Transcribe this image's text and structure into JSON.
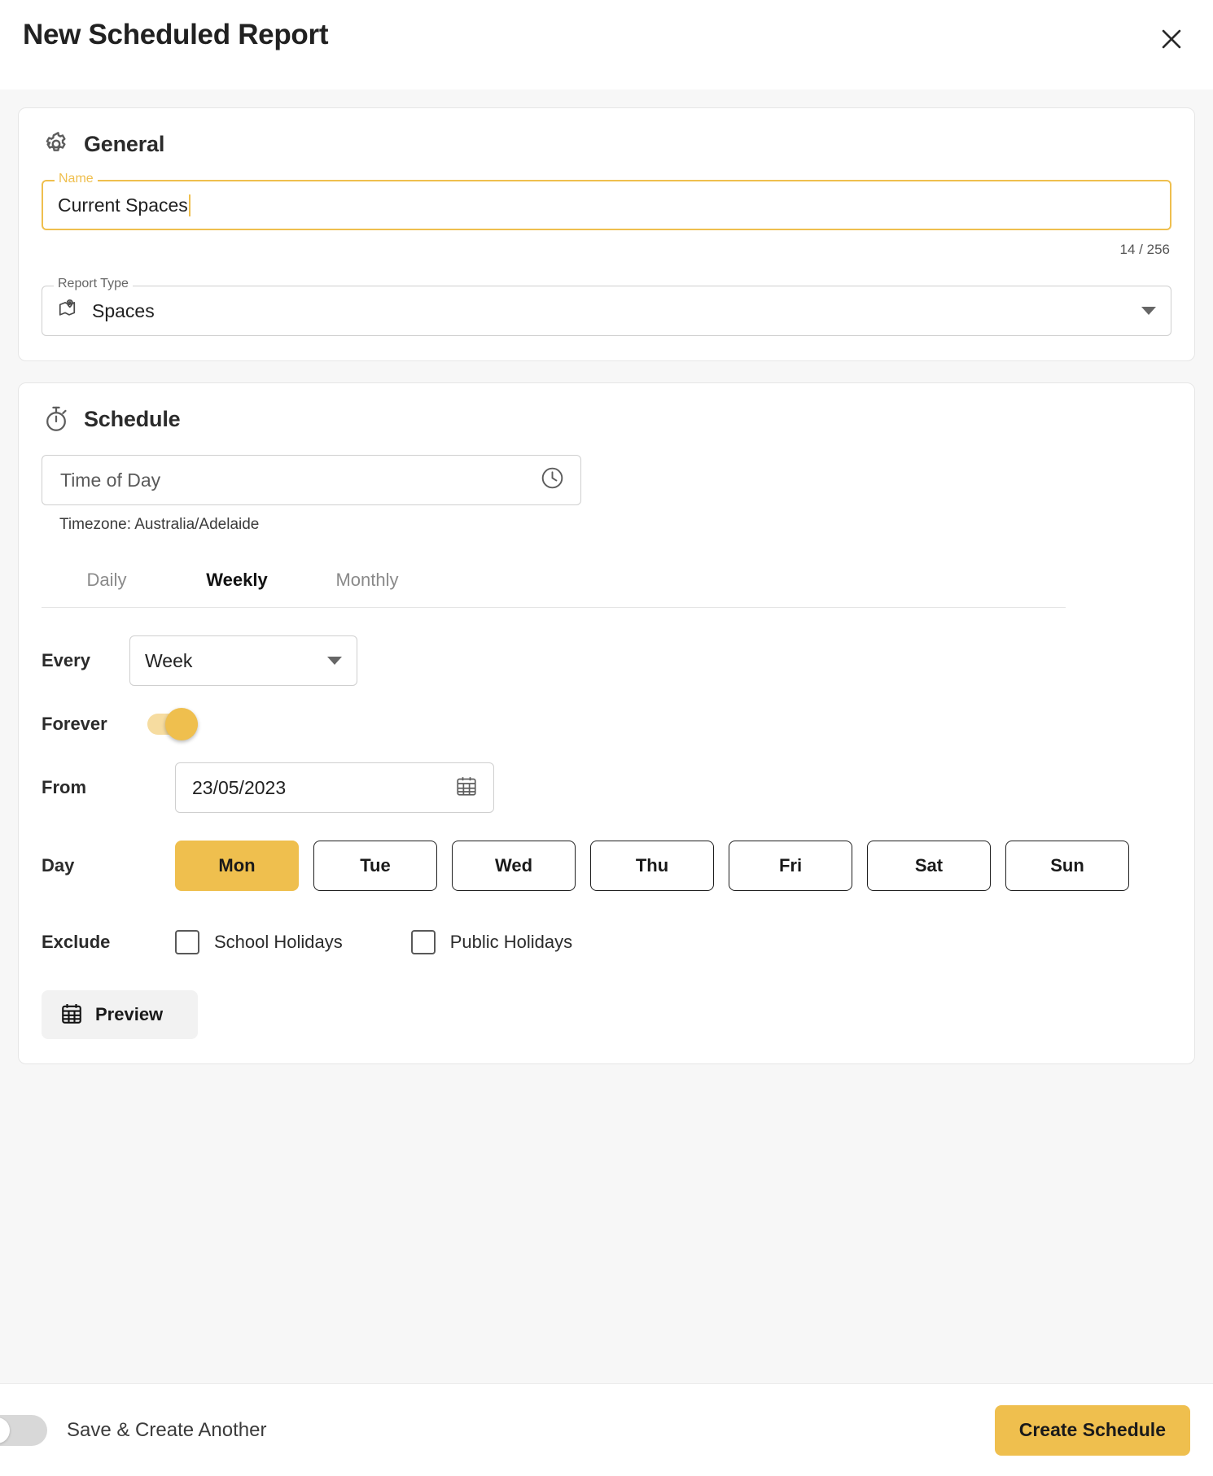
{
  "header": {
    "title": "New Scheduled Report",
    "close_icon": "close-icon"
  },
  "general": {
    "section_title": "General",
    "section_icon": "gear-icon",
    "name_field": {
      "label": "Name",
      "value": "Current Spaces",
      "counter": "14 / 256"
    },
    "report_type": {
      "label": "Report Type",
      "value": "Spaces",
      "icon": "map-pin-icon",
      "caret_icon": "chevron-down-icon"
    }
  },
  "schedule": {
    "section_title": "Schedule",
    "section_icon": "stopwatch-icon",
    "time_of_day": {
      "placeholder": "Time of Day",
      "value": "",
      "icon": "clock-icon"
    },
    "timezone": "Timezone: Australia/Adelaide",
    "tabs": [
      {
        "label": "Daily",
        "active": false
      },
      {
        "label": "Weekly",
        "active": true
      },
      {
        "label": "Monthly",
        "active": false
      }
    ],
    "every": {
      "label": "Every",
      "value": "Week",
      "caret_icon": "chevron-down-icon"
    },
    "forever": {
      "label": "Forever",
      "state": "on"
    },
    "from": {
      "label": "From",
      "value": "23/05/2023",
      "icon": "calendar-icon"
    },
    "day": {
      "label": "Day",
      "options": [
        {
          "label": "Mon",
          "selected": true
        },
        {
          "label": "Tue",
          "selected": false
        },
        {
          "label": "Wed",
          "selected": false
        },
        {
          "label": "Thu",
          "selected": false
        },
        {
          "label": "Fri",
          "selected": false
        },
        {
          "label": "Sat",
          "selected": false
        },
        {
          "label": "Sun",
          "selected": false
        }
      ]
    },
    "exclude": {
      "label": "Exclude",
      "options": [
        {
          "label": "School Holidays",
          "checked": false
        },
        {
          "label": "Public Holidays",
          "checked": false
        }
      ]
    },
    "preview_button": {
      "label": "Preview",
      "icon": "calendar-grid-icon"
    }
  },
  "footer": {
    "save_create_another": {
      "label": "Save & Create Another",
      "state": "off"
    },
    "primary_button": "Create Schedule"
  },
  "colors": {
    "accent": "#EFBF4E",
    "accent_light": "#F6DCA0",
    "body_bg": "#F7F7F7",
    "card_bg": "#FFFFFF",
    "text": "#212121"
  }
}
